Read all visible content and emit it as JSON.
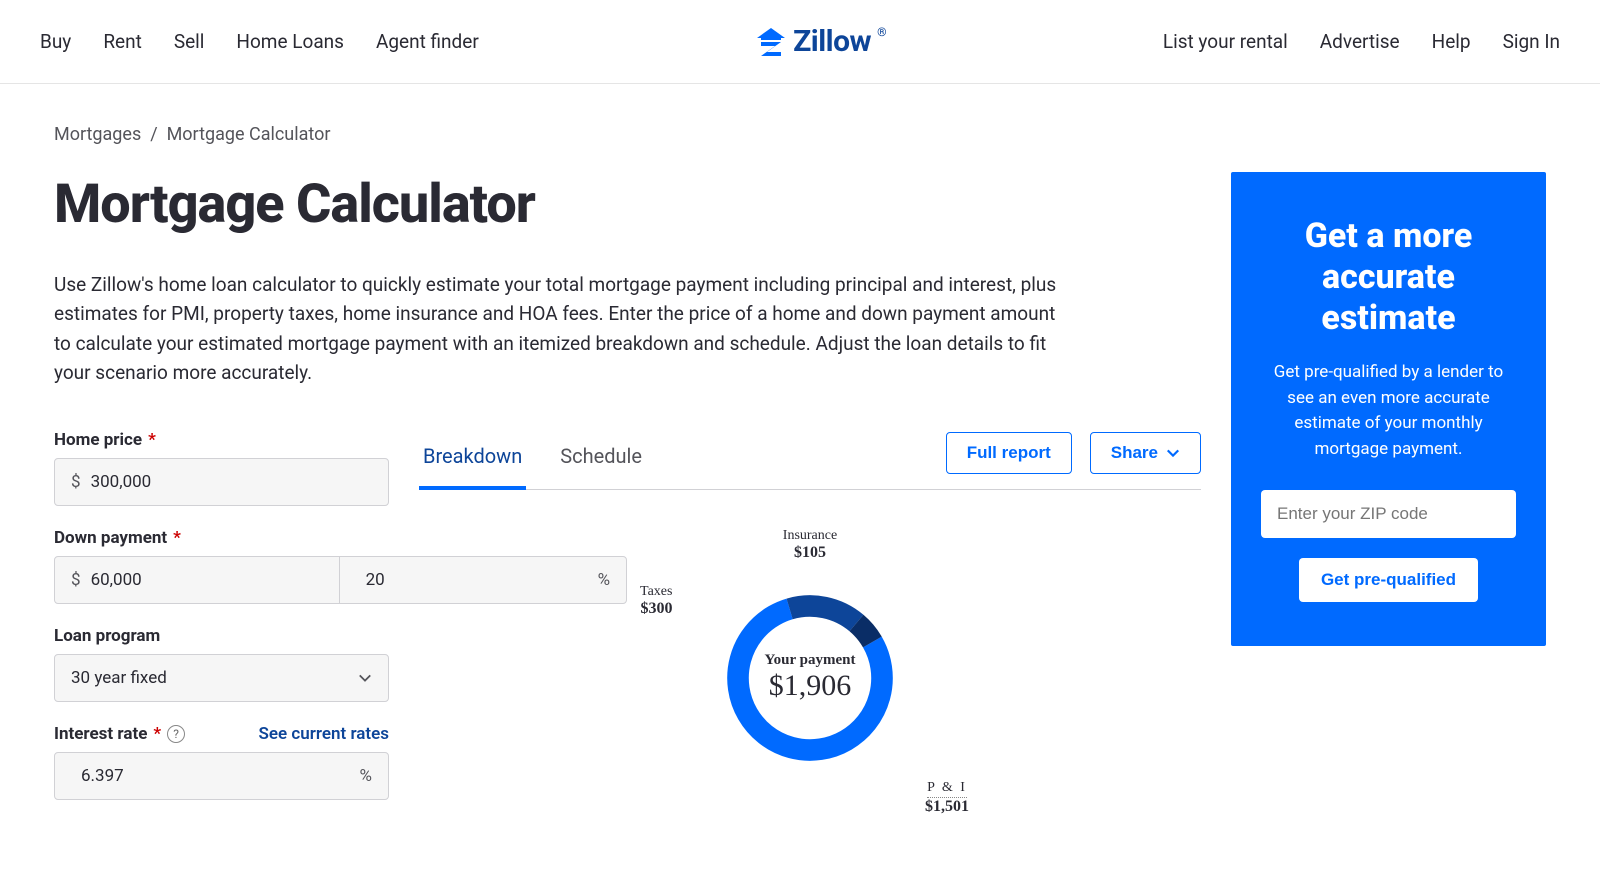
{
  "nav": {
    "left": [
      "Buy",
      "Rent",
      "Sell",
      "Home Loans",
      "Agent finder"
    ],
    "right": [
      "List your rental",
      "Advertise",
      "Help",
      "Sign In"
    ],
    "brand": "Zillow"
  },
  "breadcrumb": {
    "parent": "Mortgages",
    "sep": "/",
    "current": "Mortgage Calculator"
  },
  "title": "Mortgage Calculator",
  "intro": "Use Zillow's home loan calculator to quickly estimate your total mortgage payment including principal and interest, plus estimates for PMI, property taxes, home insurance and HOA fees. Enter the price of a home and down payment amount to calculate your estimated mortgage payment with an itemized breakdown and schedule. Adjust the loan details to fit your scenario more accurately.",
  "form": {
    "home_price": {
      "label": "Home price",
      "required": "*",
      "prefix": "$",
      "value": "300,000"
    },
    "down_payment": {
      "label": "Down payment",
      "required": "*",
      "prefix": "$",
      "value": "60,000",
      "pct": "20",
      "pct_suffix": "%"
    },
    "loan_program": {
      "label": "Loan program",
      "value": "30 year fixed"
    },
    "interest_rate": {
      "label": "Interest rate",
      "required": "*",
      "link": "See current rates",
      "value": "6.397",
      "suffix": "%"
    }
  },
  "output": {
    "tabs": {
      "breakdown": "Breakdown",
      "schedule": "Schedule"
    },
    "actions": {
      "full_report": "Full report",
      "share": "Share"
    },
    "center_label": "Your payment",
    "center_value": "$1,906",
    "segments": {
      "insurance": {
        "name": "Insurance",
        "val": "$105"
      },
      "taxes": {
        "name": "Taxes",
        "val": "$300"
      },
      "pi": {
        "name": "P & I",
        "val": "$1,501"
      }
    }
  },
  "promo": {
    "heading": "Get a more accurate estimate",
    "body": "Get pre-qualified by a lender to see an even more accurate estimate of your monthly mortgage payment.",
    "placeholder": "Enter your ZIP code",
    "cta": "Get pre-qualified"
  },
  "chart_data": {
    "type": "pie",
    "title": "Your payment $1,906",
    "categories": [
      "P & I",
      "Taxes",
      "Insurance"
    ],
    "values": [
      1501,
      300,
      105
    ],
    "colors": [
      "#006aff",
      "#0d4599",
      "#0a2d66"
    ]
  }
}
